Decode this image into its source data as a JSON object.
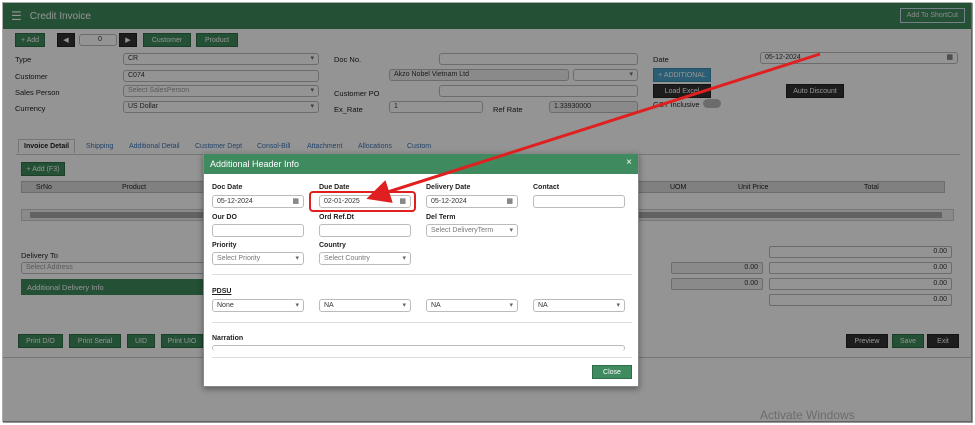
{
  "app": {
    "title": "Credit Invoice",
    "shortcut": "Add To ShortCut"
  },
  "toolbar": {
    "add": "+ Add",
    "prev": "◀",
    "record": "0",
    "next": "▶",
    "customer": "Customer",
    "product": "Product"
  },
  "header": {
    "type_label": "Type",
    "type_value": "CR",
    "customer_label": "Customer",
    "customer_value": "C074",
    "customer_name": "Akzo Nobel Vietnam Ltd",
    "salesperson_label": "Sales Person",
    "salesperson_placeholder": "Select SalesPerson",
    "currency_label": "Currency",
    "currency_value": "US Dollar",
    "docno_label": "Doc No.",
    "custpo_label": "Customer PO",
    "exrate_label": "Ex_Rate",
    "exrate_value": "1",
    "refrate_label": "Ref Rate",
    "refrate_value": "1.33930000",
    "date_label": "Date",
    "date_value": "05-12-2024",
    "additional_btn": "+ ADDITIONAL",
    "load_excel": "Load Excel",
    "auto_discount": "Auto Discount",
    "gst_inclusive": "GST Inclusive"
  },
  "tabs": [
    "Invoice Detail",
    "Shipping",
    "Additional Detail",
    "Customer Dept",
    "Consol-Bill",
    "Attachment",
    "Allocations",
    "Custom"
  ],
  "grid": {
    "add_btn": "+ Add (F3)",
    "cols": [
      "SrNo",
      "Product",
      "UOM",
      "Unit Price",
      "Total"
    ]
  },
  "delivery": {
    "label": "Delivery To",
    "address_placeholder": "Select Address",
    "info_bar": "Additional Delivery Info"
  },
  "totals": [
    "0.00",
    "0.00",
    "0.00",
    "0.00",
    "0.00",
    "0.00",
    "0.00"
  ],
  "footer": {
    "print_do": "Print D/O",
    "print_serial": "Print Serial",
    "uid": "UID",
    "print_uio": "Print UIO",
    "preview": "Preview",
    "save": "Save",
    "exit": "Exit"
  },
  "modal": {
    "title": "Additional Header Info",
    "doc_date_label": "Doc Date",
    "doc_date": "05-12-2024",
    "due_date_label": "Due Date",
    "due_date": "02-01-2025",
    "delivery_date_label": "Delivery Date",
    "delivery_date": "05-12-2024",
    "contact_label": "Contact",
    "our_do_label": "Our DO",
    "ord_ref_label": "Ord Ref.Dt",
    "del_term_label": "Del Term",
    "del_term_placeholder": "Select DeliveryTerm",
    "priority_label": "Priority",
    "priority_placeholder": "Select Priority",
    "country_label": "Country",
    "country_placeholder": "Select Country",
    "pdsu_label": "PDSU",
    "pdsu_values": [
      "None",
      "NA",
      "NA",
      "NA"
    ],
    "narration_label": "Narration",
    "close": "Close"
  },
  "watermark": "Activate Windows",
  "colors": {
    "brand": "#3f8a5e",
    "highlight": "#e02020"
  }
}
